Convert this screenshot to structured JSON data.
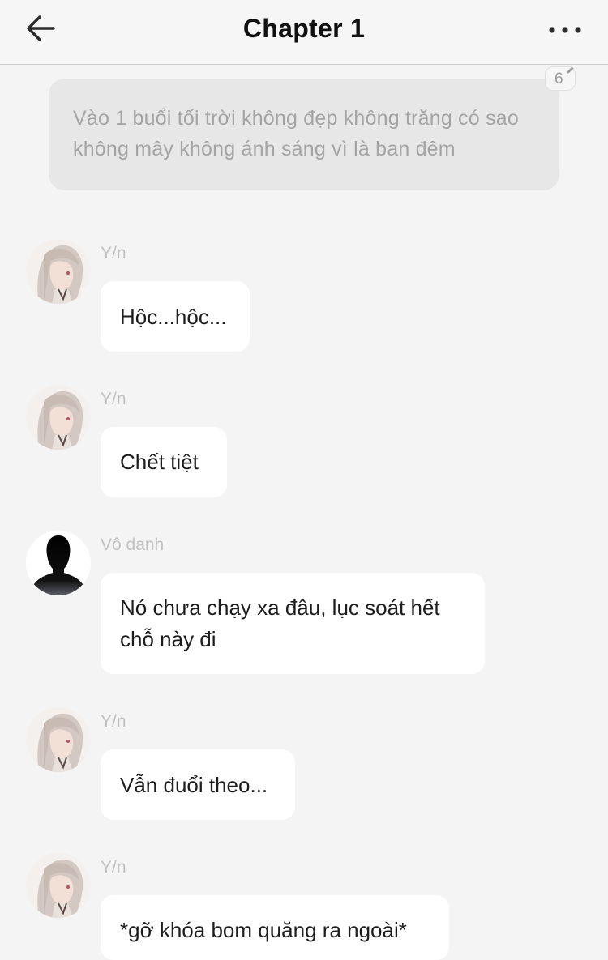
{
  "header": {
    "title": "Chapter 1",
    "back_icon": "back-arrow-icon",
    "more_icon": "more-horizontal-icon"
  },
  "narration": {
    "text": "Vào 1 buổi tối trời không đẹp không trăng có sao không mây không ánh sáng vì là ban đêm",
    "comment_count": "6"
  },
  "messages": [
    {
      "sender": "Y/n",
      "text": "Hộc...hộc...",
      "avatar": "girl-avatar"
    },
    {
      "sender": "Y/n",
      "text": "Chết tiệt",
      "avatar": "girl-avatar"
    },
    {
      "sender": "Vô danh",
      "text": "Nó chưa chạy xa đâu, lục soát hết chỗ này đi",
      "avatar": "silhouette-avatar"
    },
    {
      "sender": "Y/n",
      "text": "Vẫn đuổi theo...",
      "avatar": "girl-avatar"
    },
    {
      "sender": "Y/n",
      "text": "*gỡ khóa bom quăng ra ngoài*",
      "avatar": "girl-avatar"
    }
  ]
}
